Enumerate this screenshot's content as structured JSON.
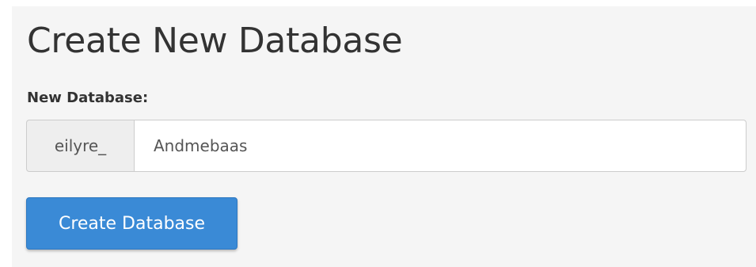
{
  "page": {
    "title": "Create New Database"
  },
  "form": {
    "label": "New Database:",
    "prefix": "eilyre_",
    "input_value": "Andmebaas",
    "submit_label": "Create Database"
  },
  "colors": {
    "panel_background": "#f5f5f5",
    "button_background": "#3a8ad6",
    "prefix_background": "#eeeeee",
    "text": "#333333"
  }
}
